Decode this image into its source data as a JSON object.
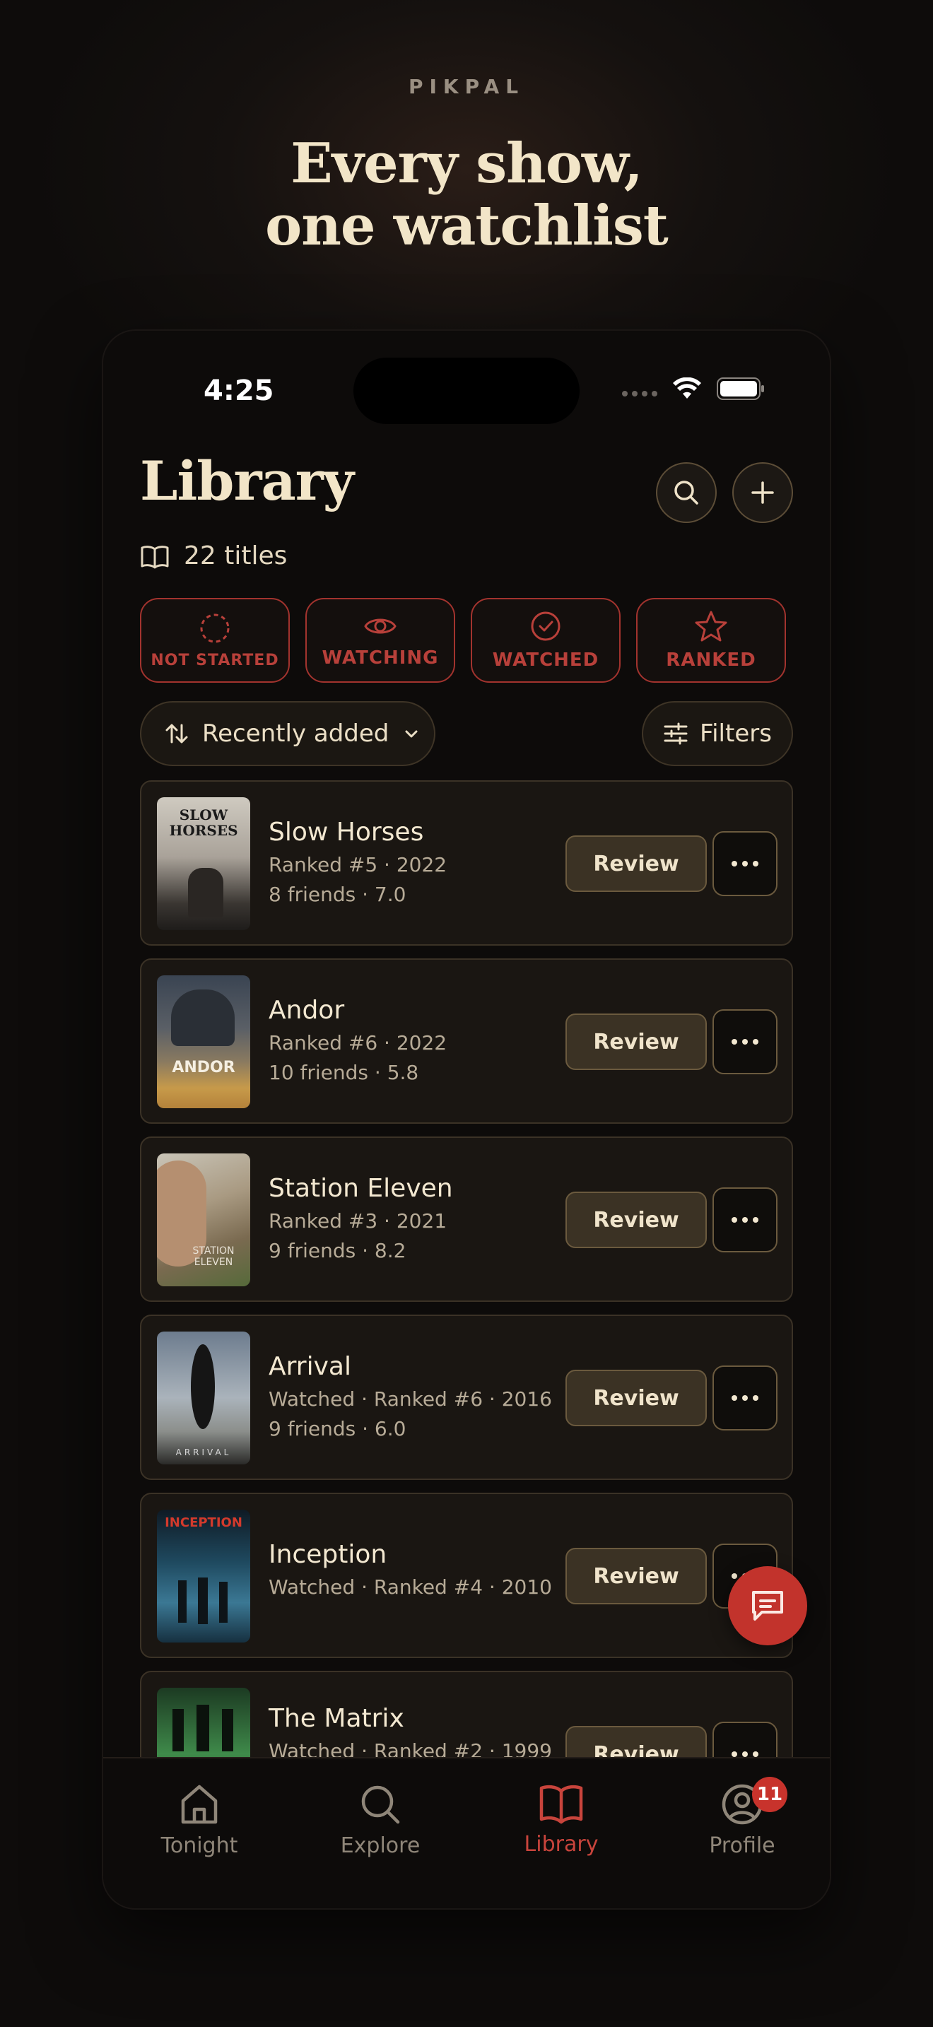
{
  "brand": "PIKPAL",
  "headline": {
    "line1": "Every show,",
    "line2": "one watchlist"
  },
  "status_bar": {
    "time": "4:25"
  },
  "library": {
    "title": "Library",
    "count": "22 titles"
  },
  "status_filters": [
    {
      "label": "NOT STARTED",
      "icon": "dashed-circle-icon"
    },
    {
      "label": "WATCHING",
      "icon": "eye-icon"
    },
    {
      "label": "WATCHED",
      "icon": "check-circle-icon"
    },
    {
      "label": "RANKED",
      "icon": "star-icon"
    }
  ],
  "sort": {
    "label": "Recently added"
  },
  "filters": {
    "label": "Filters"
  },
  "items": [
    {
      "title": "Slow Horses",
      "meta1": "Ranked #5 · 2022",
      "meta2": "8 friends · 7.0",
      "review": "Review",
      "poster_text": "SLOW HORSES"
    },
    {
      "title": "Andor",
      "meta1": "Ranked #6 · 2022",
      "meta2": "10 friends · 5.8",
      "review": "Review",
      "poster_text": "ANDOR"
    },
    {
      "title": "Station Eleven",
      "meta1": "Ranked #3 · 2021",
      "meta2": "9 friends · 8.2",
      "review": "Review",
      "poster_text": "STATION ELEVEN"
    },
    {
      "title": "Arrival",
      "meta1": "Watched · Ranked #6 · 2016",
      "meta2": "9 friends · 6.0",
      "review": "Review",
      "poster_text": "ARRIVAL"
    },
    {
      "title": "Inception",
      "meta1": "Watched · Ranked #4 · 2010",
      "meta2": "",
      "review": "Review",
      "poster_text": "INCEPTION"
    },
    {
      "title": "The Matrix",
      "meta1": "Watched · Ranked #2 · 1999",
      "meta2": "",
      "review": "Review",
      "poster_text": ""
    }
  ],
  "tabs": [
    {
      "label": "Tonight",
      "icon": "home-icon"
    },
    {
      "label": "Explore",
      "icon": "search-icon"
    },
    {
      "label": "Library",
      "icon": "book-icon",
      "active": true
    },
    {
      "label": "Profile",
      "icon": "profile-icon",
      "badge": "11"
    }
  ],
  "colors": {
    "accent": "#c2332c",
    "cream": "#f2e5c8",
    "card": "#1a1612"
  }
}
